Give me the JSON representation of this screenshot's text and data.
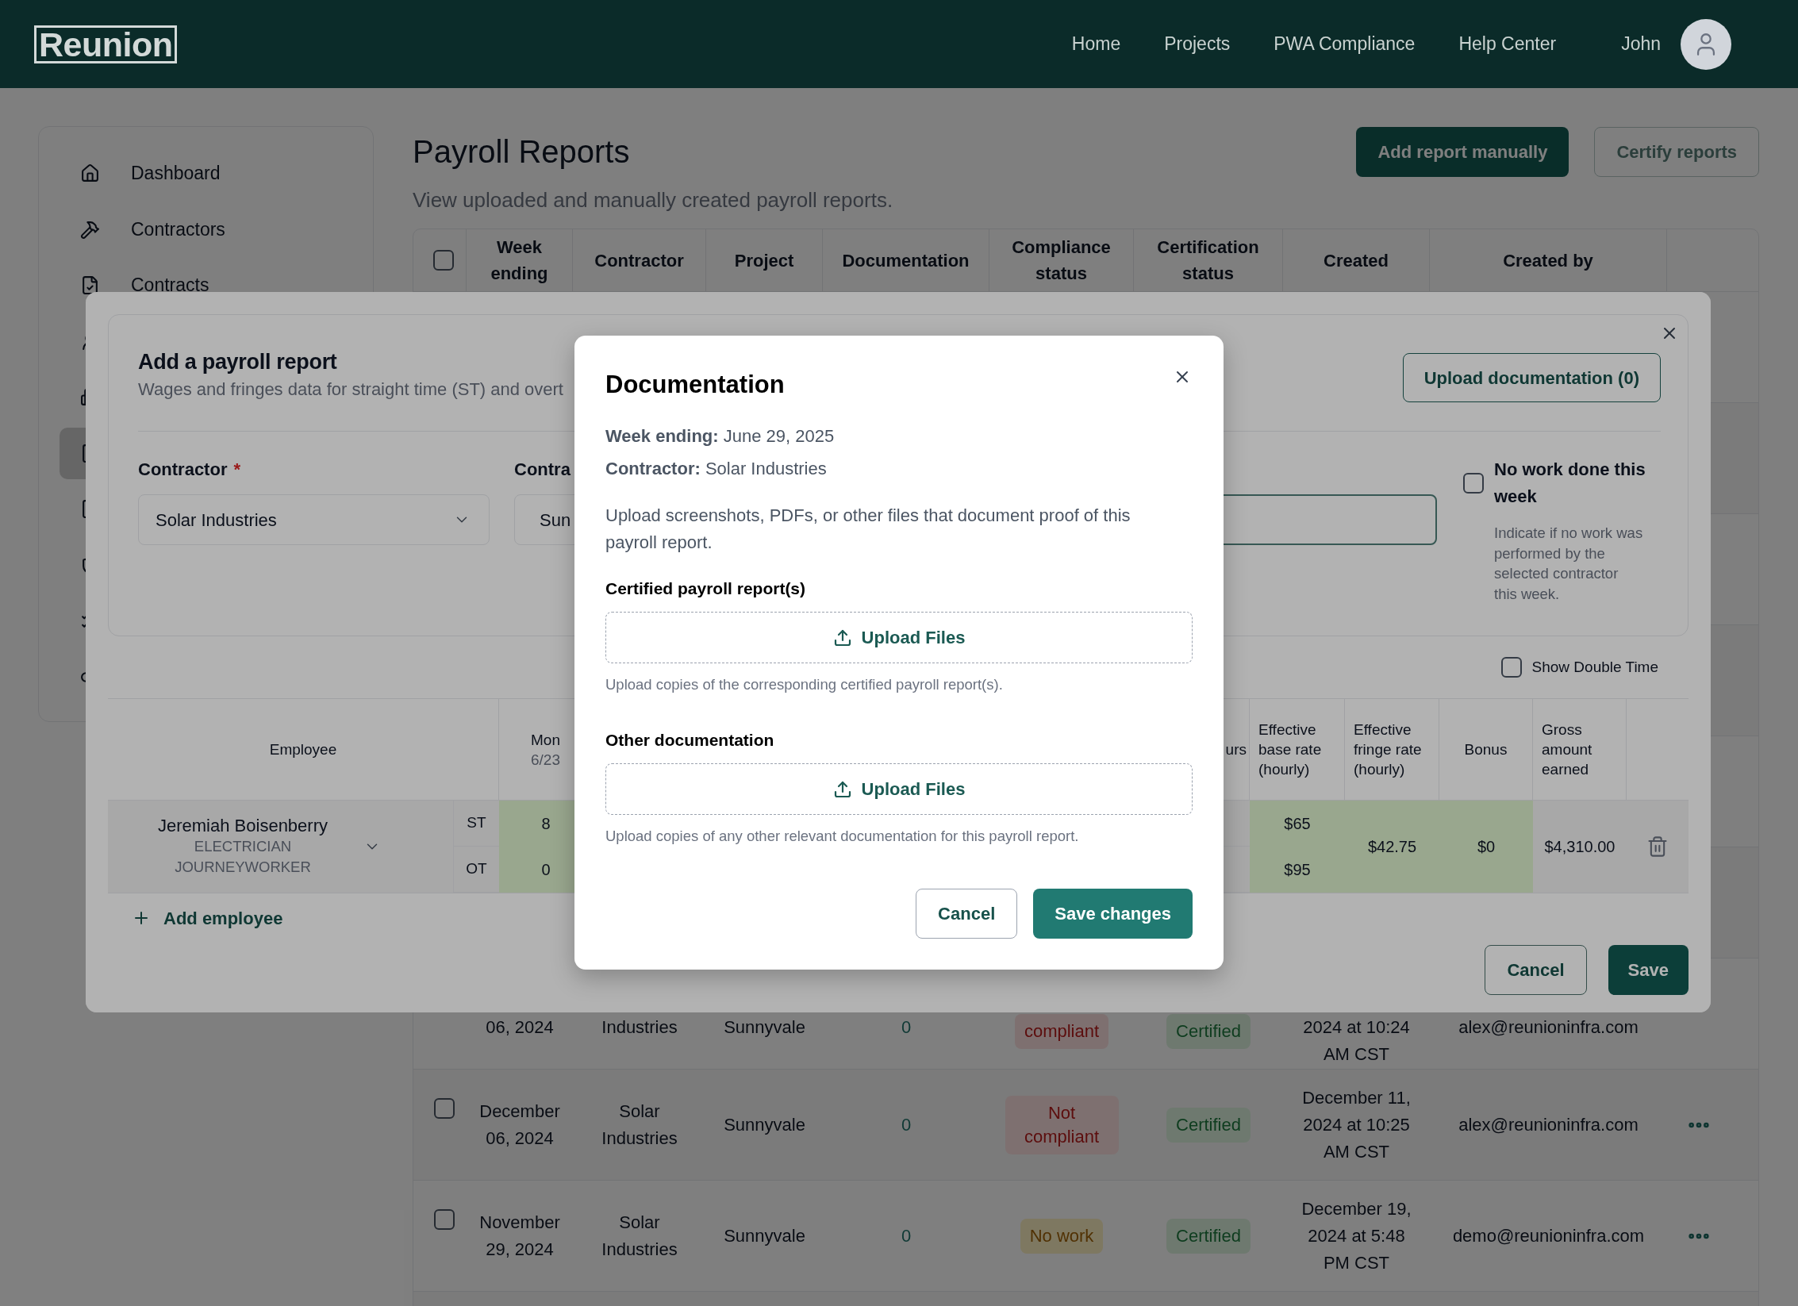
{
  "header": {
    "logo": "Reunion",
    "nav": [
      {
        "label": "Home"
      },
      {
        "label": "Projects"
      },
      {
        "label": "PWA Compliance"
      },
      {
        "label": "Help Center"
      }
    ],
    "user": {
      "name": "John"
    }
  },
  "sidebar": {
    "items": [
      {
        "label": "Dashboard",
        "selected": false
      },
      {
        "label": "Contractors",
        "selected": false
      },
      {
        "label": "Contracts",
        "selected": false
      },
      {
        "selected": false
      },
      {
        "selected": false
      },
      {
        "selected": true
      },
      {
        "selected": false
      },
      {
        "selected": false
      },
      {
        "selected": false
      },
      {
        "selected": false
      }
    ]
  },
  "page": {
    "title": "Payroll Reports",
    "subtitle": "View uploaded and manually created payroll reports.",
    "actions": [
      {
        "label": "Add report manually",
        "kind": "primary",
        "disabled": false
      },
      {
        "label": "Certify reports",
        "kind": "outline",
        "disabled": true
      }
    ]
  },
  "table": {
    "select_all": {
      "checked": false
    },
    "columns": [
      "Week ending",
      "Contractor",
      "Project",
      "Documentation",
      "Compliance status",
      "Certification status",
      "Created",
      "Created by"
    ],
    "rows": [
      {
        "kind": "partial",
        "week_ending": "06, 2024",
        "contractor": "Industries",
        "project": "Sunnyvale",
        "documentation": "0",
        "compliance": {
          "label": "compliant",
          "kind": "danger"
        },
        "certification": {
          "label": "Certified",
          "kind": "success"
        },
        "created": "2024 at 10:24 AM CST",
        "created_by": "alex@reunioninfra.com"
      },
      {
        "kind": "full",
        "checked": false,
        "week_ending": "December 06, 2024",
        "contractor": "Solar Industries",
        "project": "Sunnyvale",
        "documentation": "0",
        "compliance": {
          "label": "Not compliant",
          "kind": "danger"
        },
        "certification": {
          "label": "Certified",
          "kind": "success"
        },
        "created": "December 11, 2024 at 10:25 AM CST",
        "created_by": "alex@reunioninfra.com"
      },
      {
        "kind": "full",
        "checked": false,
        "week_ending": "November 29, 2024",
        "contractor": "Solar Industries",
        "project": "Sunnyvale",
        "documentation": "0",
        "compliance": {
          "label": "No work",
          "kind": "warning"
        },
        "certification": {
          "label": "Certified",
          "kind": "success"
        },
        "created": "December 19, 2024 at 5:48 PM CST",
        "created_by": "demo@reunioninfra.com"
      }
    ]
  },
  "payroll_modal": {
    "title": "Add a payroll report",
    "subtitle": "Wages and fringes data for straight time (ST) and overt",
    "upload_button": "Upload documentation (0)",
    "contractor": {
      "label": "Contractor",
      "required_mark": "*",
      "value": "Solar Industries"
    },
    "contract": {
      "label": "Contra",
      "value": "Sun"
    },
    "week_field": {
      "focused": true
    },
    "no_work": {
      "label": "No work done this week",
      "checked": false,
      "hint": "Indicate if no work was performed by the selected contractor this week."
    },
    "show_double_time": {
      "label": "Show Double Time",
      "checked": false
    },
    "employee_table": {
      "columns": [
        {
          "label": "Employee"
        },
        {
          "label": "Mon",
          "sub": "6/23",
          "editable": true
        },
        {
          "label": "urs",
          "editable": false
        },
        {
          "label": "Effective base rate (hourly)",
          "editable": true
        },
        {
          "label": "Effective fringe rate (hourly)",
          "editable": true
        },
        {
          "label": "Bonus",
          "editable": true
        },
        {
          "label": "Gross amount earned",
          "editable": false
        }
      ],
      "rows": [
        {
          "name": "Jeremiah Boisenberry",
          "role": "ELECTRICIAN JOURNEYWORKER",
          "expanded": false,
          "lines": [
            {
              "label": "ST",
              "mon": "8",
              "base_rate": "$65"
            },
            {
              "label": "OT",
              "mon": "0",
              "base_rate": "$95"
            }
          ],
          "fringe_rate": "$42.75",
          "bonus": "$0",
          "gross": "$4,310.00"
        }
      ]
    },
    "add_employee": "Add employee",
    "cancel": "Cancel",
    "save": "Save"
  },
  "documentation_dialog": {
    "title": "Documentation",
    "meta": [
      "**Week ending:** June 29, 2025",
      "**Contractor:** Solar Industries"
    ],
    "description": "Upload screenshots, PDFs, or other files that document proof of this payroll report.",
    "sections": [
      {
        "title": "Certified payroll report(s)",
        "button": "Upload Files",
        "hint": "Upload copies of the corresponding certified payroll report(s)."
      },
      {
        "title": "Other documentation",
        "button": "Upload Files",
        "hint": "Upload copies of any other relevant documentation for this payroll report."
      }
    ],
    "cancel": "Cancel",
    "save": "Save changes"
  }
}
